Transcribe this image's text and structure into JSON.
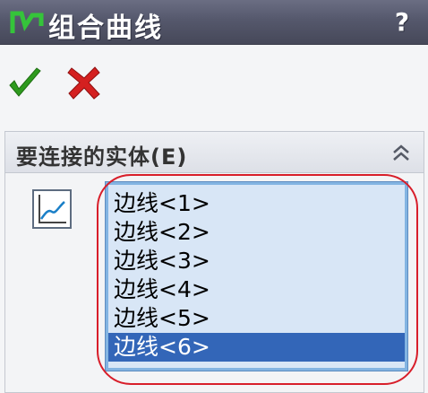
{
  "titlebar": {
    "title": "组合曲线",
    "help_label": "?"
  },
  "toolbar": {
    "ok_icon": "checkmark-icon",
    "cancel_icon": "x-icon"
  },
  "section": {
    "title": "要连接的实体(E)",
    "collapse_icon": "double-chevron-up-icon",
    "entity_icon": "curve-icon"
  },
  "entities": {
    "items": [
      "边线<1>",
      "边线<2>",
      "边线<3>",
      "边线<4>",
      "边线<5>",
      "边线<6>"
    ],
    "selected_index": 5
  },
  "colors": {
    "titlebar": "#55586c",
    "ok_green": "#2e9a1e",
    "cancel_red": "#d42020",
    "selection": "#3366b8",
    "list_background": "#d8e6f6",
    "highlight_ring": "#d81e2a"
  }
}
